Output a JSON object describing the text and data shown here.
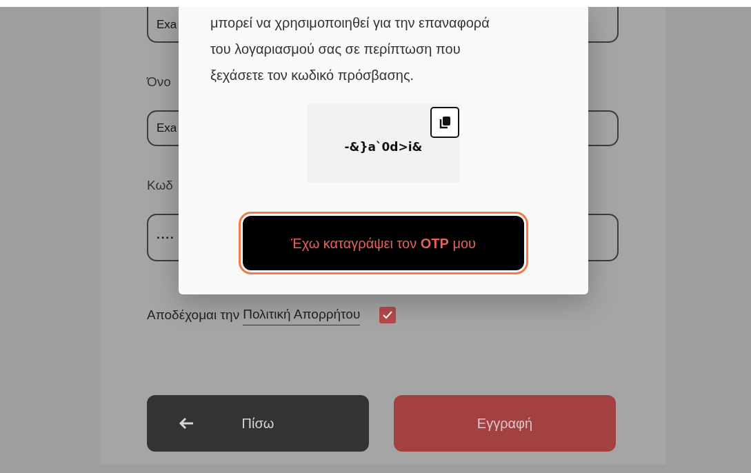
{
  "form": {
    "fields": [
      {
        "value": "Exa"
      },
      {
        "label": "Όνο",
        "value": "Exa"
      },
      {
        "label": "Κωδ",
        "value": "····"
      }
    ],
    "consent": {
      "text": "Αποδέχομαι την",
      "link": "Πολιτική Απορρήτου",
      "checked": true
    },
    "buttons": [
      {
        "label": "Πίσω",
        "kind": "back"
      },
      {
        "label": "Εγγραφή",
        "kind": "primary"
      }
    ]
  },
  "modal": {
    "text": "μπορεί να χρησιμοποιηθεί για την επαναφορά\nτου λογαριασμού σας σε περίπτωση που\nξεχάσετε τον κωδικό πρόσβασης.",
    "otp": "-&}a`0d>i&",
    "confirm_button": "Έχω καταγράψει τον **OTP** μου",
    "confirm_focused": true
  }
}
